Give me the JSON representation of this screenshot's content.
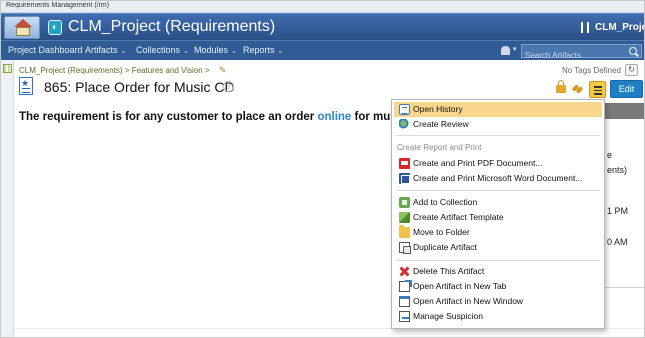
{
  "app_label": "Requirements Management (/rm)",
  "project_title": "CLM_Project (Requirements)",
  "right_title": "CLM_Project",
  "nav": {
    "items": [
      {
        "label": "Project Dashboard"
      },
      {
        "label": "Artifacts"
      },
      {
        "label": "Collections"
      },
      {
        "label": "Modules"
      },
      {
        "label": "Reports"
      }
    ],
    "chevron": "⌄",
    "dropdown_glyph": "▾",
    "search_placeholder": "Search Artifacts"
  },
  "breadcrumb": "CLM_Project (Requirements) > Features and Vision >",
  "pencil_glyph": "✎",
  "tags_text": "No Tags Defined",
  "tag_edit_glyph": "↻",
  "artifact": {
    "star_glyph": "★",
    "title": "865: Place Order for Music CD",
    "help_glyph": "?"
  },
  "buttons": {
    "edit": "Edit"
  },
  "description": {
    "before": "The requirement is for any customer to place an order ",
    "link": "online",
    "after": " for musi"
  },
  "side_fragments": [
    "e",
    "ents)",
    "1 PM",
    "0 AM"
  ],
  "menu": {
    "group1": [
      {
        "label": "Open History",
        "icon": "history-icon",
        "highlighted": true
      },
      {
        "label": "Create Review",
        "icon": "review-icon"
      }
    ],
    "section_label": "Create Report and Print",
    "group2": [
      {
        "label": "Create and Print PDF Document...",
        "icon": "pdf-icon"
      },
      {
        "label": "Create and Print Microsoft Word Document...",
        "icon": "word-icon"
      }
    ],
    "group3": [
      {
        "label": "Add to Collection",
        "icon": "collection-icon"
      },
      {
        "label": "Create Artifact Template",
        "icon": "template-icon"
      },
      {
        "label": "Move to Folder",
        "icon": "folder-icon"
      },
      {
        "label": "Duplicate Artifact",
        "icon": "duplicate-icon"
      }
    ],
    "group4": [
      {
        "label": "Delete This Artifact",
        "icon": "delete-icon"
      },
      {
        "label": "Open Artifact in New Tab",
        "icon": "new-tab-icon"
      },
      {
        "label": "Open Artifact in New Window",
        "icon": "new-window-icon"
      },
      {
        "label": "Manage Suspicion",
        "icon": "suspicion-icon"
      }
    ]
  },
  "colors": {
    "banner": "#2f5c95",
    "menu_highlight": "#f8d68c",
    "edit_button": "#1f7fc6",
    "link": "#2a86c8"
  }
}
